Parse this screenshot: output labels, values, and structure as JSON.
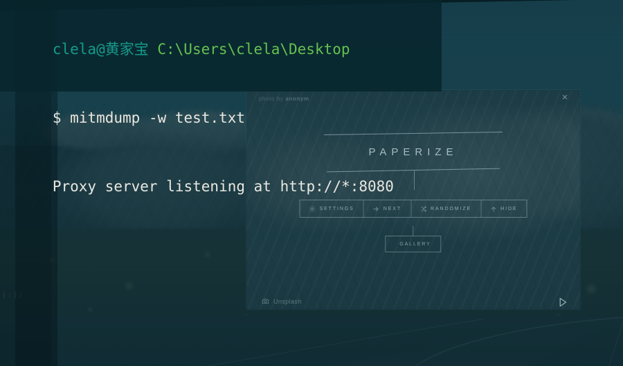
{
  "terminal": {
    "prompt_user": "clela@黄家宝",
    "prompt_path": "C:\\Users\\clela\\Desktop",
    "dollar": "$",
    "command": "mitmdump -w test.txt",
    "output": "Proxy server listening at http://*:8080",
    "colors": {
      "user": "#159b8a",
      "path": "#66c14e",
      "foreground": "#e8e8e0",
      "background": "#082630"
    }
  },
  "paperize": {
    "title": "PAPERIZE",
    "credit_prefix": "photo by",
    "credit_author": "anonym",
    "close_label": "×",
    "buttons": [
      {
        "label": "SETTINGS",
        "icon": "gear-icon"
      },
      {
        "label": "NEXT",
        "icon": "arrow-right-icon"
      },
      {
        "label": "RANDOMIZE",
        "icon": "shuffle-icon"
      },
      {
        "label": "HIDE",
        "icon": "arrow-up-icon"
      }
    ],
    "gallery": {
      "label": "GALLERY",
      "icon": "image-icon"
    },
    "source": {
      "label": "Unsplash",
      "icon": "camera-icon"
    },
    "next_arrow_icon": "play-next-icon",
    "colors": {
      "ui_line": "#c4dbe0",
      "overlay": "#10343e"
    }
  },
  "desktop": {
    "wallpaper_description": "desert mountain road landscape",
    "ghost_text": "|:|:"
  }
}
